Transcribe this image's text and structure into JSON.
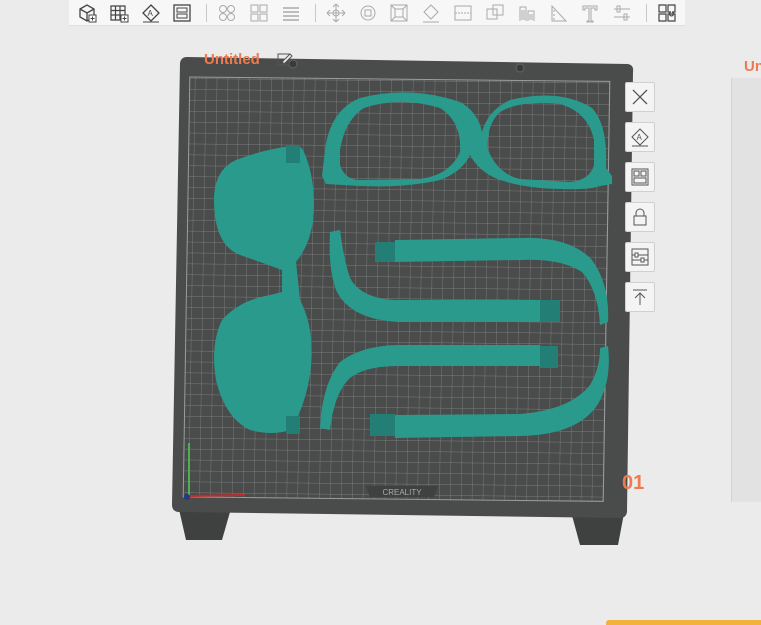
{
  "toolbar": {
    "buttons": [
      {
        "name": "add-cube-icon"
      },
      {
        "name": "add-plate-icon"
      },
      {
        "name": "auto-orient-icon"
      },
      {
        "name": "arrange-icon"
      },
      {
        "name": "split-objects-icon"
      },
      {
        "name": "split-parts-icon"
      },
      {
        "name": "layers-icon"
      },
      {
        "name": "move-icon"
      },
      {
        "name": "rotate-icon"
      },
      {
        "name": "scale-icon"
      },
      {
        "name": "lay-on-face-icon"
      },
      {
        "name": "cut-icon"
      },
      {
        "name": "boolean-icon"
      },
      {
        "name": "support-paint-icon"
      },
      {
        "name": "seam-paint-icon"
      },
      {
        "name": "text-icon"
      },
      {
        "name": "measure-icon"
      },
      {
        "name": "assembly-icon"
      }
    ]
  },
  "plate": {
    "title": "Untitled",
    "number": "01",
    "brand": "CREALITY",
    "model_color": "#2a9a8d",
    "bed_color": "#4a4b4b",
    "accent": "#ef7a4f"
  },
  "side_tools": [
    {
      "name": "close-plate-icon"
    },
    {
      "name": "auto-orient-plate-icon"
    },
    {
      "name": "arrange-plate-icon"
    },
    {
      "name": "lock-plate-icon"
    },
    {
      "name": "plate-settings-icon"
    },
    {
      "name": "move-to-top-icon"
    }
  ],
  "second_plate": {
    "title": "Untitled"
  }
}
